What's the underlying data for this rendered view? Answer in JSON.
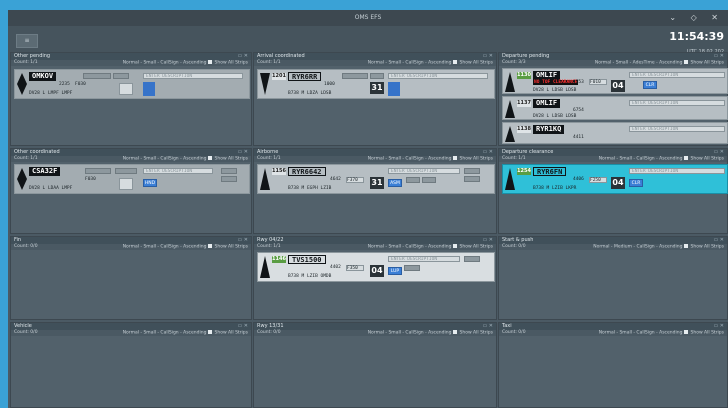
{
  "window": {
    "title": "OMS EFS",
    "controls": "⌄ ◇ ✕"
  },
  "topbar": {
    "menu_btn": "≡",
    "clock": "11:54:39",
    "utc": "UTC 18.02.202"
  },
  "panels": [
    {
      "title": "Other pending",
      "count": "Count: 1/1",
      "opts": "Normal - Small - CallSign - Ascending",
      "show": "Show All Strips"
    },
    {
      "title": "Arrival coordinated",
      "count": "Count: 1/1",
      "opts": "Normal - Small - CallSign - Ascending",
      "show": "Show All Strips"
    },
    {
      "title": "Departure pending",
      "count": "Count: 3/3",
      "opts": "Normal - Small - AdesTime - Ascending",
      "show": "Show All Strips"
    },
    {
      "title": "Other coordinated",
      "count": "Count: 1/1",
      "opts": "Normal - Small - CallSign - Ascending",
      "show": "Show All Strips"
    },
    {
      "title": "Airborne",
      "count": "Count: 1/1",
      "opts": "Normal - Small - CallSign - Ascending",
      "show": "Show All Strips"
    },
    {
      "title": "Departure clearance",
      "count": "Count: 1/1",
      "opts": "Normal - Small - CallSign - Ascending",
      "show": "Show All Strips"
    },
    {
      "title": "Fin",
      "count": "Count: 0/0",
      "opts": "Normal - Small - CallSign - Ascending",
      "show": "Show All Strips"
    },
    {
      "title": "Rwy 04/22",
      "count": "Count: 1/1",
      "opts": "Normal - Small - CallSign - Ascending",
      "show": "Show All Strips"
    },
    {
      "title": "Start & push",
      "count": "Count: 0/0",
      "opts": "Normal - Medium - CallSign - Ascending",
      "show": "Show All Strips"
    },
    {
      "title": "Vehicle",
      "count": "Count: 0/0",
      "opts": "Normal - Small - CallSign - Ascending",
      "show": "Show All Strips"
    },
    {
      "title": "Rwy 13/31",
      "count": "Count: 0/0",
      "opts": "Normal - Small - CallSign - Ascending",
      "show": "Show All Strips"
    },
    {
      "title": "Taxi",
      "count": "Count: 0/0",
      "opts": "Normal - Small - CallSign - Ascending",
      "show": "Show All Strips"
    }
  ],
  "strips": {
    "omkov": {
      "callsign": "OMKOV",
      "code": "2235",
      "fl": "F030",
      "route": "DV28  L  LMPF  LMPF",
      "desc": "ENTER DESCRIPTION"
    },
    "ryr6rr": {
      "num": "1201",
      "callsign": "RYR6RR",
      "code": "1000",
      "route": "B738  M  LDZA  LDSB",
      "rwy": "31",
      "desc": "ENTER DESCRIPTION"
    },
    "omlif1": {
      "num": "1130",
      "callsign": "OMLIF",
      "warn": "NO TOF CLEARANCE",
      "code": "4753",
      "fl": "F010",
      "route": "DV28  L  LDSB  LDSB",
      "rwy": "04",
      "desc": "ENTER DESCRIPTION",
      "tag": "CLR"
    },
    "csa32f": {
      "callsign": "CSA32F",
      "fl": "F030",
      "route": "DV28  L  LDAA  LMPF",
      "desc": "ENTER DESCRIPTION",
      "tag": "HND"
    },
    "ryr6642": {
      "num": "1156",
      "callsign": "RYR6642",
      "code": "4642",
      "fl": "F370",
      "route": "B738  M  EGPH  LZIB",
      "rwy": "31",
      "desc": "ENTER DESCRIPTION",
      "tag": "ASM"
    },
    "omlif2": {
      "num": "1137",
      "callsign": "OMLIF",
      "code": "6754",
      "route": "DV28  L  LDSB  LDSB",
      "desc": "ENTER DESCRIPTION"
    },
    "ryr1kq": {
      "num": "1138",
      "callsign": "RYR1KQ",
      "code": "4411",
      "desc": "ENTER DESCRIPTION"
    },
    "ryr6fn": {
      "num": "1254",
      "callsign": "RYR6FN",
      "code": "4406",
      "fl": "F250",
      "route": "B738  M  LZIB  LKPR",
      "rwy": "04",
      "desc": "ENTER DESCRIPTION",
      "tag": "CLR"
    },
    "tvs1500": {
      "num": "1146",
      "callsign": "TVS1500",
      "code": "4402",
      "fl": "F350",
      "route": "B738  M  LZIB  OMDB",
      "rwy": "04",
      "desc": "ENTER DESCRIPTION",
      "tag": "LUP"
    }
  },
  "colors": {
    "accent": "#3aa2d6",
    "cyan_strip": "#2fc0d8",
    "bg": "#4b5a64"
  }
}
